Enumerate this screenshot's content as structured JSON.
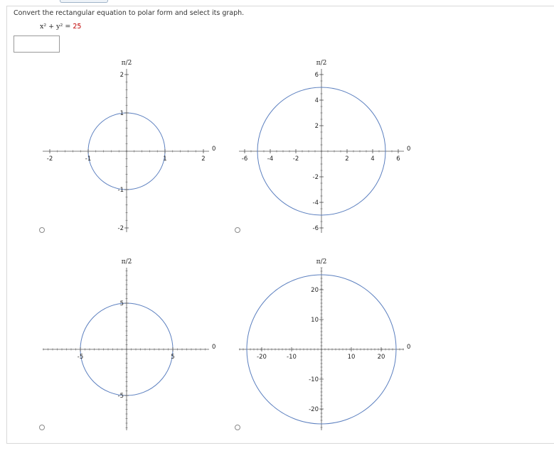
{
  "prompt": "Convert the rectangular equation to polar form and select its graph.",
  "equation": {
    "lhs": "x² + y² =",
    "rhs": "25"
  },
  "answer_box": {
    "value": ""
  },
  "options": [
    {
      "top_label": "π/2",
      "right_label": "0",
      "circle_radius": 1,
      "x_ticks": [
        "-2",
        "-1",
        "1",
        "2"
      ],
      "y_ticks": [
        "2",
        "1",
        "-1",
        "-2"
      ]
    },
    {
      "top_label": "π/2",
      "right_label": "0",
      "circle_radius": 5,
      "x_ticks": [
        "-6",
        "-4",
        "-2",
        "2",
        "4",
        "6"
      ],
      "y_ticks": [
        "6",
        "4",
        "2",
        "-2",
        "-4",
        "-6"
      ]
    },
    {
      "top_label": "π/2",
      "right_label": "0",
      "circle_radius": 5,
      "x_ticks": [
        "-5",
        "5"
      ],
      "y_ticks": [
        "5",
        "-5"
      ]
    },
    {
      "top_label": "π/2",
      "right_label": "0",
      "circle_radius": 25,
      "x_ticks": [
        "-20",
        "-10",
        "10",
        "20"
      ],
      "y_ticks": [
        "20",
        "10",
        "-10",
        "-20"
      ]
    }
  ],
  "colors": {
    "circle": "#5b7fbf",
    "axis": "#555555",
    "equation_value": "#c00000"
  }
}
